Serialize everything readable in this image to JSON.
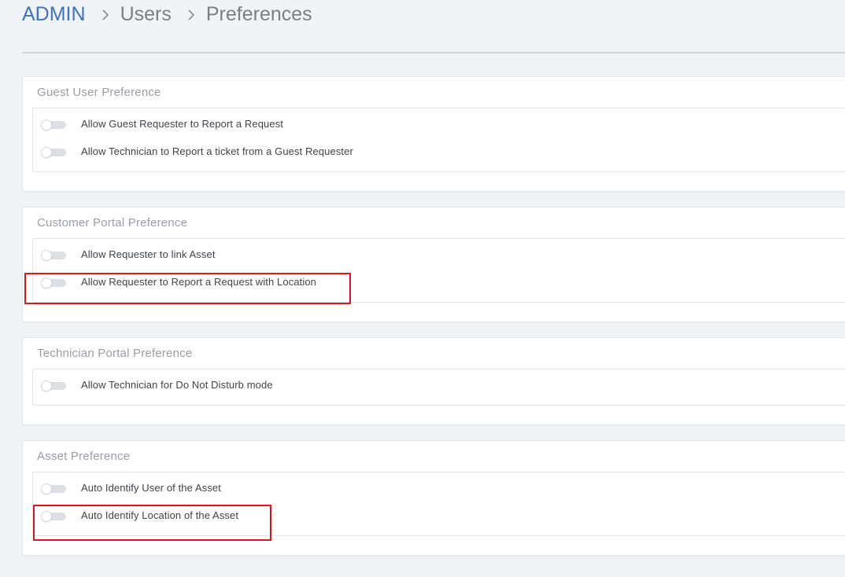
{
  "breadcrumb": {
    "admin": "ADMIN",
    "users": "Users",
    "current": "Preferences"
  },
  "sections": [
    {
      "title": "Guest User Preference",
      "items": [
        {
          "label": "Allow Guest Requester to Report a Request",
          "enabled": false
        },
        {
          "label": "Allow Technician to Report a ticket from a Guest Requester",
          "enabled": false
        }
      ]
    },
    {
      "title": "Customer Portal Preference",
      "items": [
        {
          "label": "Allow Requester to link Asset",
          "enabled": false
        },
        {
          "label": "Allow Requester to Report a Request with Location",
          "enabled": false
        }
      ]
    },
    {
      "title": "Technician Portal Preference",
      "items": [
        {
          "label": "Allow Technician for Do Not Disturb mode",
          "enabled": false
        }
      ]
    },
    {
      "title": "Asset Preference",
      "items": [
        {
          "label": "Auto Identify User of the Asset",
          "enabled": false
        },
        {
          "label": "Auto Identify Location of the Asset",
          "enabled": false
        }
      ]
    }
  ],
  "colors": {
    "accent": "#3e73c4",
    "highlight": "#e0141b",
    "background": "#f1f4f7"
  }
}
